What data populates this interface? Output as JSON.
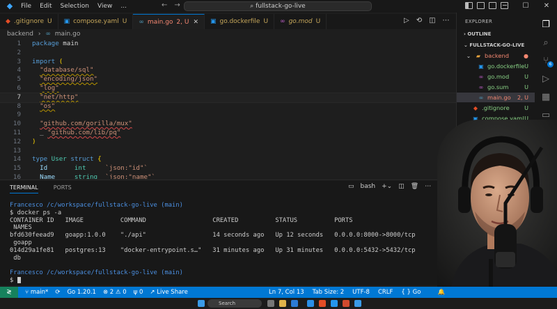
{
  "titlebar": {
    "menu": [
      "File",
      "Edit",
      "Selection",
      "View",
      "..."
    ],
    "command_center": "fullstack-go-live",
    "nav_icons": [
      "arrow-left-icon",
      "arrow-right-icon"
    ],
    "window_controls": [
      "minimize-icon",
      "maximize-icon",
      "close-icon"
    ]
  },
  "tabs": [
    {
      "label": ".gitignore",
      "status": "U",
      "icon": "git-icon"
    },
    {
      "label": "compose.yaml",
      "status": "U",
      "icon": "docker-icon"
    },
    {
      "label": "main.go",
      "status": "2, U",
      "icon": "go-icon",
      "active": true
    },
    {
      "label": "go.dockerfile",
      "status": "U",
      "icon": "docker-icon"
    },
    {
      "label": "go.mod",
      "status": "U",
      "icon": "go-icon"
    }
  ],
  "breadcrumb": {
    "folder": "backend",
    "file": "main.go"
  },
  "editor": {
    "line_numbers": [
      "1",
      "2",
      "3",
      "4",
      "5",
      "6",
      "7",
      "8",
      "9",
      "10",
      "11",
      "12",
      "13",
      "14",
      "15",
      "16"
    ],
    "current_line": "7",
    "lines": {
      "l1": [
        "package",
        " main"
      ],
      "l3": [
        "import",
        " ("
      ],
      "l4": "\"database/sql\"",
      "l5": "\"encoding/json\"",
      "l6": "\"log\"",
      "l7": "\"net/http\"",
      "l8": "\"os\"",
      "l10": "\"github.com/gorilla/mux\"",
      "l11_prefix": "_",
      "l11": "\"github.com/lib/pq\"",
      "l12": ")",
      "l14": [
        "type",
        " User ",
        "struct",
        " {"
      ],
      "l15": [
        "Id",
        "int",
        "`json:\"id\"`"
      ],
      "l16": [
        "Name",
        "string",
        "`json:\"name\"`"
      ]
    }
  },
  "panel": {
    "tabs": [
      "TERMINAL",
      "PORTS"
    ],
    "shell": "bash",
    "terminal": {
      "prompt_user": "Francesco",
      "prompt_path": "/c/workspace/fullstack-go-live",
      "prompt_branch": "(main)",
      "command": "$ docker ps -a",
      "header": "CONTAINER ID   IMAGE          COMMAND                  CREATED          STATUS          PORTS",
      "header2": " NAMES",
      "rows": [
        "bfd630feead9   goapp:1.0.0    \"./api\"                  14 seconds ago   Up 12 seconds   0.0.0.0:8000->8000/tcp",
        " goapp",
        "014d29a1fe81   postgres:13    \"docker-entrypoint.s…\"   31 minutes ago   Up 31 minutes   0.0.0.0:5432->5432/tcp",
        " db"
      ],
      "prompt2_user": "Francesco",
      "prompt2_path": "/c/workspace/fullstack-go-live",
      "prompt2_branch": "(main)",
      "final_prompt": "$ "
    }
  },
  "explorer": {
    "title": "EXPLORER",
    "outline": "OUTLINE",
    "root": "FULLSTACK-GO-LIVE",
    "items": [
      {
        "name": "backend",
        "status": "",
        "kind": "folder"
      },
      {
        "name": "go.dockerfile",
        "status": "U",
        "kind": "docker"
      },
      {
        "name": "go.mod",
        "status": "U",
        "kind": "go"
      },
      {
        "name": "go.sum",
        "status": "U",
        "kind": "go"
      },
      {
        "name": "main.go",
        "status": "2, U",
        "kind": "go",
        "selected": true
      },
      {
        "name": ".gitignore",
        "status": "U",
        "kind": "git"
      },
      {
        "name": "compose.yaml",
        "status": "U",
        "kind": "docker"
      }
    ]
  },
  "activitybar": {
    "icons": [
      "files-icon",
      "search-icon",
      "source-control-icon",
      "run-debug-icon",
      "extensions-icon",
      "remote-explorer-icon",
      "docker-icon",
      "testing-icon"
    ],
    "badge": "6"
  },
  "statusbar": {
    "branch": "main*",
    "sync": "⟳",
    "go_version": "Go 1.20.1",
    "errors": "2",
    "warnings": "0",
    "ports": "0",
    "live_share": "Live Share",
    "position": "Ln 7, Col 13",
    "tab_size": "Tab Size: 2",
    "encoding": "UTF-8",
    "eol": "CRLF",
    "language": "Go"
  },
  "taskbar": {
    "search": "Search"
  },
  "colors": {
    "accent": "#0078d4",
    "statusbar": "#0078d4",
    "remote": "#16825d",
    "untracked": "#89d185",
    "error": "#f48771"
  }
}
